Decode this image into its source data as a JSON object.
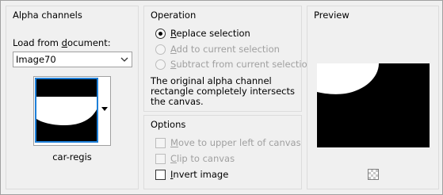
{
  "alpha_channels": {
    "title": "Alpha channels",
    "load_label_prefix": "Load from ",
    "load_label_accel": "d",
    "load_label_rest": "ocument:",
    "document_value": "Image70",
    "channel_name": "car-regis"
  },
  "operation": {
    "title": "Operation",
    "options": [
      {
        "accel": "R",
        "rest": "eplace selection",
        "selected": true,
        "enabled": true
      },
      {
        "accel": "A",
        "rest": "dd to current selection",
        "selected": false,
        "enabled": false
      },
      {
        "accel": "S",
        "rest": "ubtract from current selection",
        "selected": false,
        "enabled": false
      }
    ],
    "note": "The original alpha channel rectangle completely intersects the canvas."
  },
  "options": {
    "title": "Options",
    "checkboxes": [
      {
        "accel": "M",
        "rest": "ove to upper left of canvas",
        "checked": false,
        "enabled": false
      },
      {
        "accel": "C",
        "rest": "lip to canvas",
        "checked": false,
        "enabled": false
      },
      {
        "accel": "I",
        "rest": "nvert image",
        "checked": false,
        "enabled": true
      }
    ]
  },
  "preview": {
    "title": "Preview",
    "toggle_icon": "checkerboard-icon"
  }
}
